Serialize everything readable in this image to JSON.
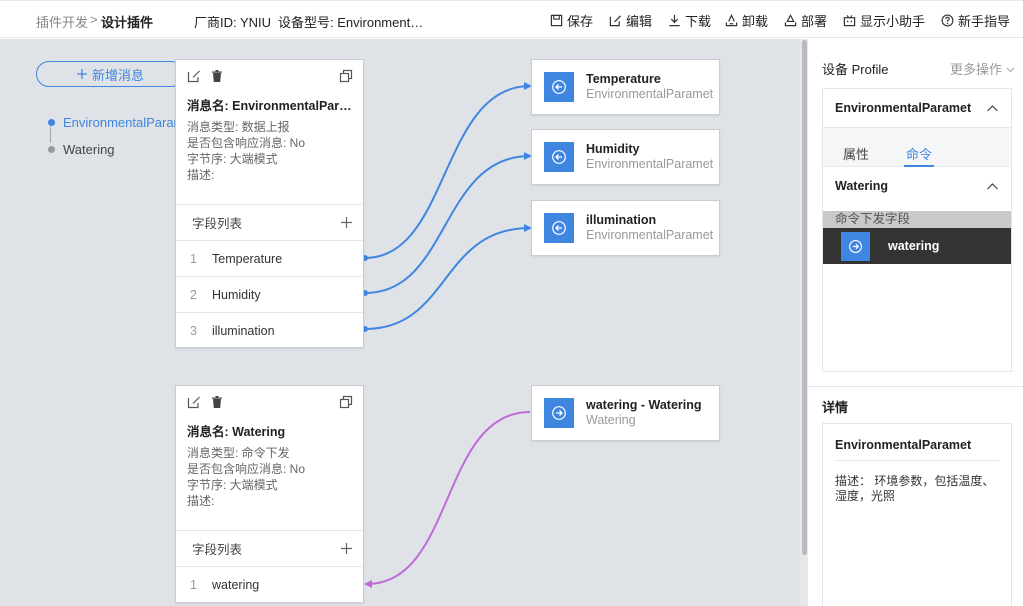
{
  "header": {
    "breadcrumb_parent": "插件开发",
    "breadcrumb_sep": ">",
    "breadcrumb_current": "设计插件",
    "vendor_id": "厂商ID: YNIU",
    "device_model": "设备型号: EnvironmentalParamet",
    "actions": {
      "save": "保存",
      "edit": "编辑",
      "download": "下载",
      "uninstall": "卸载",
      "deploy": "部署",
      "assistant": "显示小助手",
      "guide": "新手指导"
    }
  },
  "canvas": {
    "add_message": "新增消息",
    "tree": [
      {
        "label": "EnvironmentalParamet",
        "active": true
      },
      {
        "label": "Watering",
        "active": false
      }
    ],
    "messages": [
      {
        "title": "消息名: EnvironmentalParamet",
        "type": "消息类型: 数据上报",
        "has_response": "是否包含响应消息: No",
        "byte_order": "字节序: 大端模式",
        "description": "描述:",
        "fields_header": "字段列表",
        "fields": [
          {
            "index": "1",
            "name": "Temperature"
          },
          {
            "index": "2",
            "name": "Humidity"
          },
          {
            "index": "3",
            "name": "illumination"
          }
        ]
      },
      {
        "title": "消息名: Watering",
        "type": "消息类型: 命令下发",
        "has_response": "是否包含响应消息: No",
        "byte_order": "字节序: 大端模式",
        "description": "描述:",
        "fields_header": "字段列表",
        "fields": [
          {
            "index": "1",
            "name": "watering"
          }
        ]
      }
    ],
    "properties": [
      {
        "name": "Temperature",
        "service": "EnvironmentalParamet"
      },
      {
        "name": "Humidity",
        "service": "EnvironmentalParamet"
      },
      {
        "name": "illumination",
        "service": "EnvironmentalParamet"
      },
      {
        "name": "watering - Watering",
        "service": "Watering"
      }
    ],
    "link_colors": {
      "report": "#3f86e0",
      "command": "#c06ad8"
    }
  },
  "right_panel": {
    "title": "设备 Profile",
    "more": "更多操作",
    "service_name": "EnvironmentalParamet",
    "tabs": {
      "property": "属性",
      "command": "命令"
    },
    "command_name": "Watering",
    "command_section": "命令下发字段",
    "command_field": "watering",
    "detail_title": "详情",
    "detail_name": "EnvironmentalParamet",
    "detail_desc": "描述： 环境参数，包括温度、湿度，光照"
  },
  "colors": {
    "accent": "#3f86e0",
    "canvas": "#dfe3e8"
  }
}
